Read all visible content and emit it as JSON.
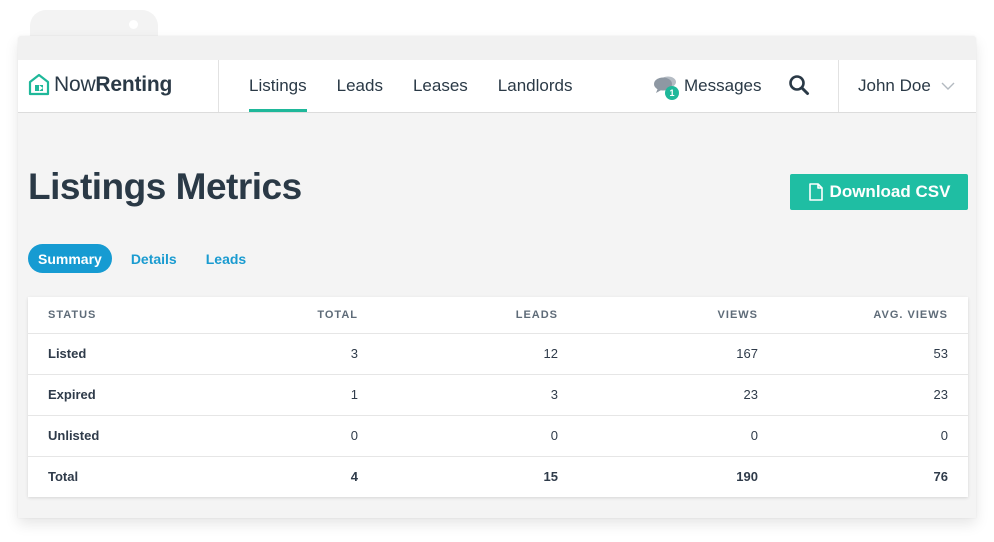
{
  "header": {
    "logo": {
      "text_light": "Now",
      "text_bold": "Renting"
    },
    "nav": [
      {
        "label": "Listings",
        "active": true
      },
      {
        "label": "Leads",
        "active": false
      },
      {
        "label": "Leases",
        "active": false
      },
      {
        "label": "Landlords",
        "active": false
      }
    ],
    "messages": {
      "label": "Messages",
      "badge": "1",
      "icon": "chat-bubbles-icon"
    },
    "search": {
      "icon": "search-icon"
    },
    "user": {
      "name": "John Doe",
      "icon": "chevron-down-icon"
    }
  },
  "main": {
    "title": "Listings Metrics",
    "download_button": {
      "label": "Download CSV",
      "icon": "file-icon"
    },
    "tabs": [
      {
        "label": "Summary",
        "active": true
      },
      {
        "label": "Details",
        "active": false
      },
      {
        "label": "Leads",
        "active": false
      }
    ],
    "table": {
      "columns": [
        "STATUS",
        "TOTAL",
        "LEADS",
        "VIEWS",
        "AVG. VIEWS"
      ],
      "rows": [
        [
          "Listed",
          "3",
          "12",
          "167",
          "53"
        ],
        [
          "Expired",
          "1",
          "3",
          "23",
          "23"
        ],
        [
          "Unlisted",
          "0",
          "0",
          "0",
          "0"
        ],
        [
          "Total",
          "4",
          "15",
          "190",
          "76"
        ]
      ]
    }
  },
  "colors": {
    "accent": "#1fb89a",
    "tab_active": "#169bd2",
    "link": "#1a9bd0",
    "text": "#2a3946"
  }
}
